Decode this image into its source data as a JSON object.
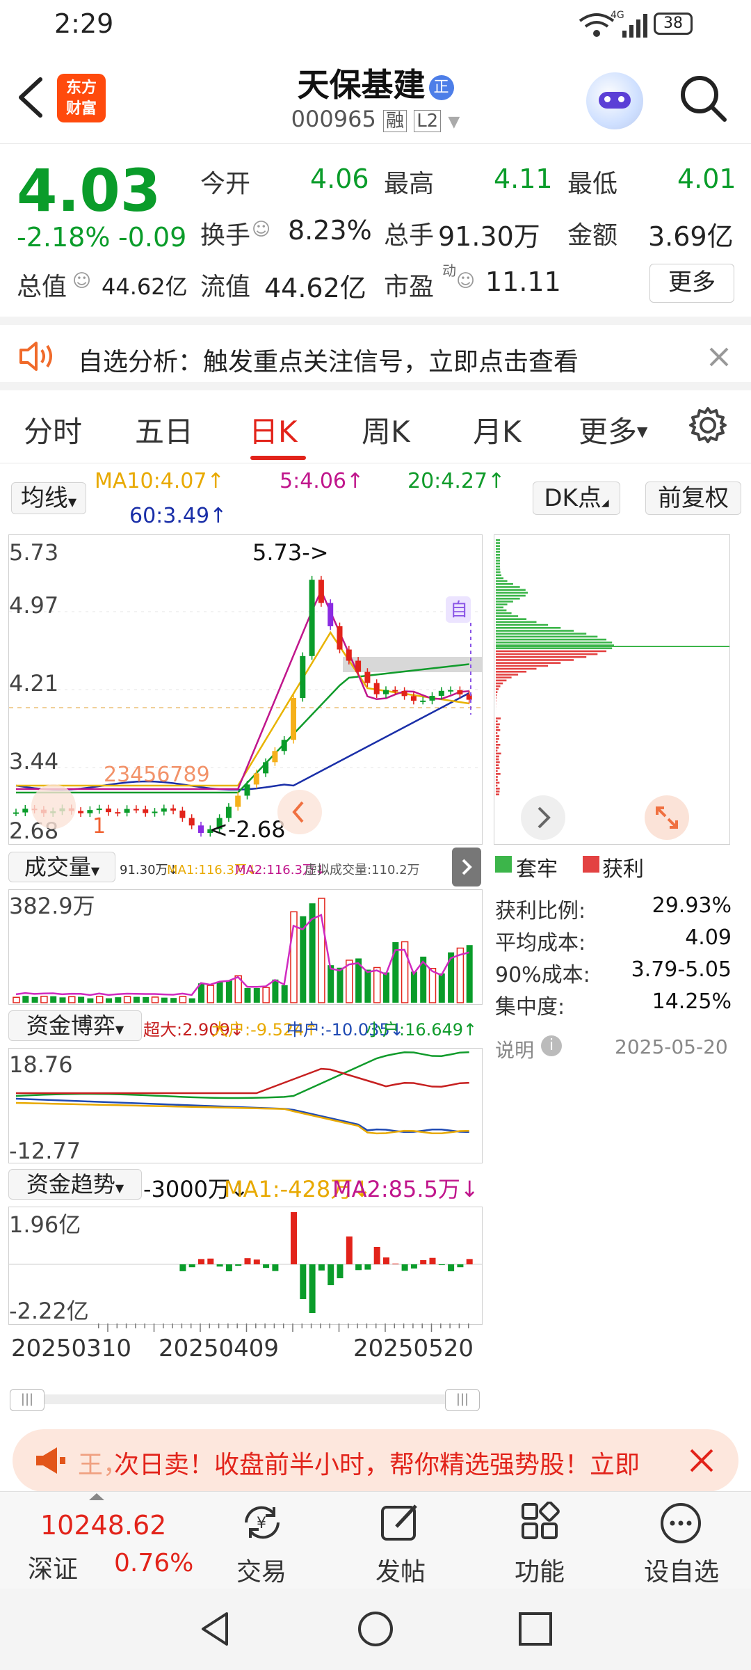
{
  "status": {
    "time": "2:29",
    "network": "4G",
    "battery": "38"
  },
  "header": {
    "app_logo": "东方\n财富",
    "title": "天保基建",
    "title_badge": "正",
    "code": "000965",
    "tag1": "融",
    "tag2": "L2"
  },
  "quote": {
    "price": "4.03",
    "change_pct": "-2.18%",
    "change": "-0.09",
    "open_label": "今开",
    "open": "4.06",
    "high_label": "最高",
    "high": "4.11",
    "low_label": "最低",
    "low": "4.01",
    "turnover_label": "换手",
    "turnover": "8.23%",
    "volume_label": "总手",
    "volume": "91.30万",
    "amount_label": "金额",
    "amount": "3.69亿",
    "mcap_label": "总值",
    "mcap": "44.62亿",
    "float_label": "流值",
    "float_mcap": "44.62亿",
    "pe_label": "市盈",
    "pe_sup": "动",
    "pe": "11.11",
    "more": "更多"
  },
  "banner": {
    "text": "自选分析：触发重点关注信号，立即点击查看"
  },
  "tabs": [
    "分时",
    "五日",
    "日K",
    "周K",
    "月K",
    "更多"
  ],
  "ma": {
    "btn": "均线",
    "ma10": "MA10:4.07↑",
    "ma5": "5:4.06↑",
    "ma20": "20:4.27↑",
    "ma60": "60:3.49↑",
    "dk": "DK点",
    "fq": "前复权"
  },
  "kline": {
    "y_top": "5.73",
    "y2": "4.97",
    "y3": "4.21",
    "y4": "3.44",
    "y_bot": "2.68",
    "hi_label": "5.73->",
    "lo_label": "<-2.68",
    "tag": "自",
    "seq": "23456789",
    "seq1": "1"
  },
  "chips": {
    "legend_trapped": "套牢",
    "legend_profit": "获利",
    "rows": [
      {
        "k": "获利比例:",
        "v": "29.93%"
      },
      {
        "k": "平均成本:",
        "v": "4.09"
      },
      {
        "k": "90%成本:",
        "v": "3.79-5.05"
      },
      {
        "k": "集中度:",
        "v": "14.25%"
      }
    ],
    "note": "说明",
    "date": "2025-05-20"
  },
  "volume": {
    "btn": "成交量",
    "info1": "91.30万↓",
    "info2": "MA1:116.3万↓",
    "info3": "MA2:116.3万↓",
    "info4": "虚拟成交量:110.2万",
    "y_top": "382.9万"
  },
  "fund": {
    "btn": "资金博弈",
    "super": "超大:2.909↓",
    "big": "大户:-9.524↑",
    "mid": "中户:-10.035↓",
    "small": "小户:16.649↑",
    "y_top": "18.76",
    "y_bot": "-12.77"
  },
  "trend": {
    "btn": "资金趋势",
    "val": "-3000万↓",
    "ma1": "MA1:-428万↓",
    "ma2": "MA2:85.5万↓",
    "y_top": "1.96亿",
    "y_bot": "-2.22亿"
  },
  "dates": [
    "20250310",
    "20250409",
    "20250520"
  ],
  "promo": {
    "text": "次日卖！收盘前半小时，帮你精选强势股！立即",
    "lead": "王，"
  },
  "bottom": {
    "index_val": "10248.62",
    "index_name": "深证",
    "index_pct": "0.76%",
    "items": [
      {
        "label": "交易",
        "icon": "trade-icon"
      },
      {
        "label": "发帖",
        "icon": "post-icon"
      },
      {
        "label": "功能",
        "icon": "grid-icon"
      },
      {
        "label": "设自选",
        "icon": "more-icon"
      }
    ]
  },
  "colors": {
    "up": "#e2231a",
    "down": "#0a9c2a",
    "accent": "#ff5a00"
  }
}
